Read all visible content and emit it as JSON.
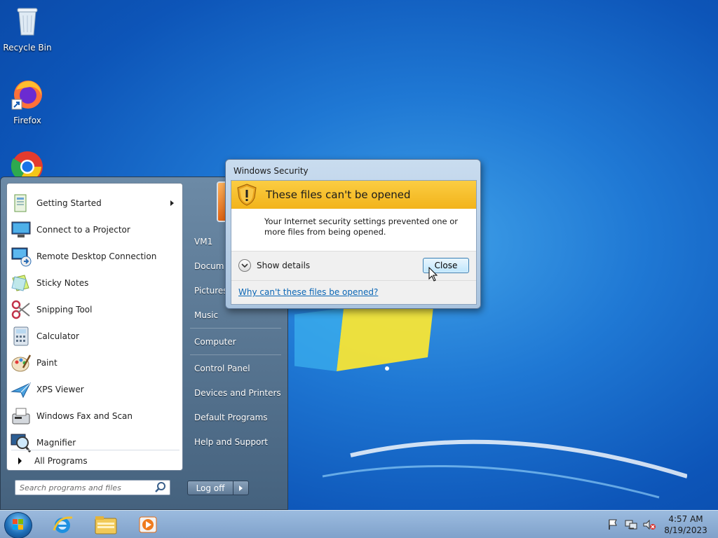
{
  "desktop": {
    "icons": [
      {
        "label": "Recycle Bin",
        "icon": "recycle-bin-icon"
      },
      {
        "label": "Firefox",
        "icon": "firefox-icon"
      },
      {
        "label": "",
        "icon": "chrome-icon"
      }
    ]
  },
  "start_menu": {
    "programs": [
      {
        "label": "Getting Started",
        "icon": "getting-started-icon",
        "submenu": true
      },
      {
        "label": "Connect to a Projector",
        "icon": "projector-icon"
      },
      {
        "label": "Remote Desktop Connection",
        "icon": "remote-desktop-icon"
      },
      {
        "label": "Sticky Notes",
        "icon": "sticky-notes-icon"
      },
      {
        "label": "Snipping Tool",
        "icon": "snipping-tool-icon"
      },
      {
        "label": "Calculator",
        "icon": "calculator-icon"
      },
      {
        "label": "Paint",
        "icon": "paint-icon"
      },
      {
        "label": "XPS Viewer",
        "icon": "xps-viewer-icon"
      },
      {
        "label": "Windows Fax and Scan",
        "icon": "fax-scan-icon"
      },
      {
        "label": "Magnifier",
        "icon": "magnifier-icon"
      }
    ],
    "all_programs": "All Programs",
    "search_placeholder": "Search programs and files",
    "right_links": [
      "VM1",
      "Documents",
      "Pictures",
      "Music",
      "Computer",
      "Control Panel",
      "Devices and Printers",
      "Default Programs",
      "Help and Support"
    ],
    "logoff_label": "Log off"
  },
  "dialog": {
    "title": "Windows Security",
    "heading": "These files can't be opened",
    "message": "Your Internet security settings prevented one or more files from being opened.",
    "show_details": "Show details",
    "close_label": "Close",
    "link": "Why can't these files be opened?",
    "banner_color": "#f6bd29"
  },
  "taskbar": {
    "pinned": [
      "start-orb",
      "internet-explorer-icon",
      "windows-explorer-icon",
      "media-player-icon"
    ],
    "tray_icons": [
      "action-center-flag-icon",
      "network-icon",
      "volume-muted-icon"
    ],
    "time": "4:57 AM",
    "date": "8/19/2023"
  }
}
